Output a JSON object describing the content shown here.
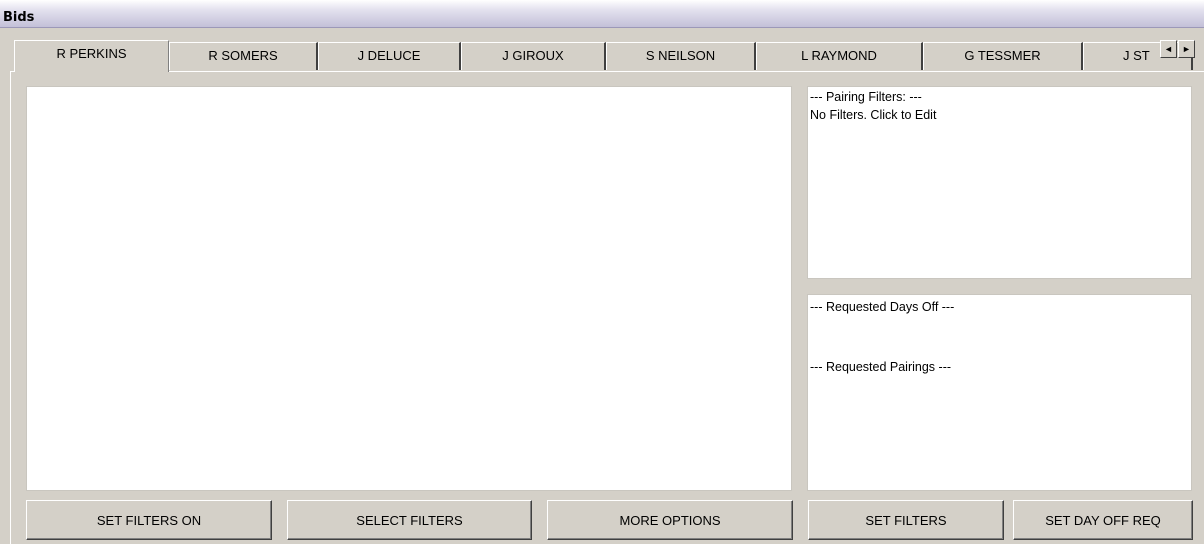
{
  "window": {
    "title": "Bids"
  },
  "tabs": [
    {
      "label": "R PERKINS",
      "active": true
    },
    {
      "label": "R SOMERS"
    },
    {
      "label": "J DELUCE"
    },
    {
      "label": "J GIROUX"
    },
    {
      "label": "S NEILSON"
    },
    {
      "label": "L RAYMOND"
    },
    {
      "label": "G TESSMER"
    },
    {
      "label": "J ST"
    }
  ],
  "tab_scroll": {
    "left_icon": "◄",
    "right_icon": "►"
  },
  "filters_panel": {
    "heading": "--- Pairing Filters: ---",
    "text": "No Filters. Click to Edit"
  },
  "requests_panel": {
    "days_off_heading": "--- Requested Days Off ---",
    "pairings_heading": "--- Requested Pairings ---"
  },
  "buttons": {
    "set_filters_on": "SET FILTERS ON",
    "select_filters": "SELECT FILTERS",
    "more_options": "MORE OPTIONS",
    "set_filters": "SET FILTERS",
    "set_day_off_req": "SET DAY OFF REQ"
  }
}
